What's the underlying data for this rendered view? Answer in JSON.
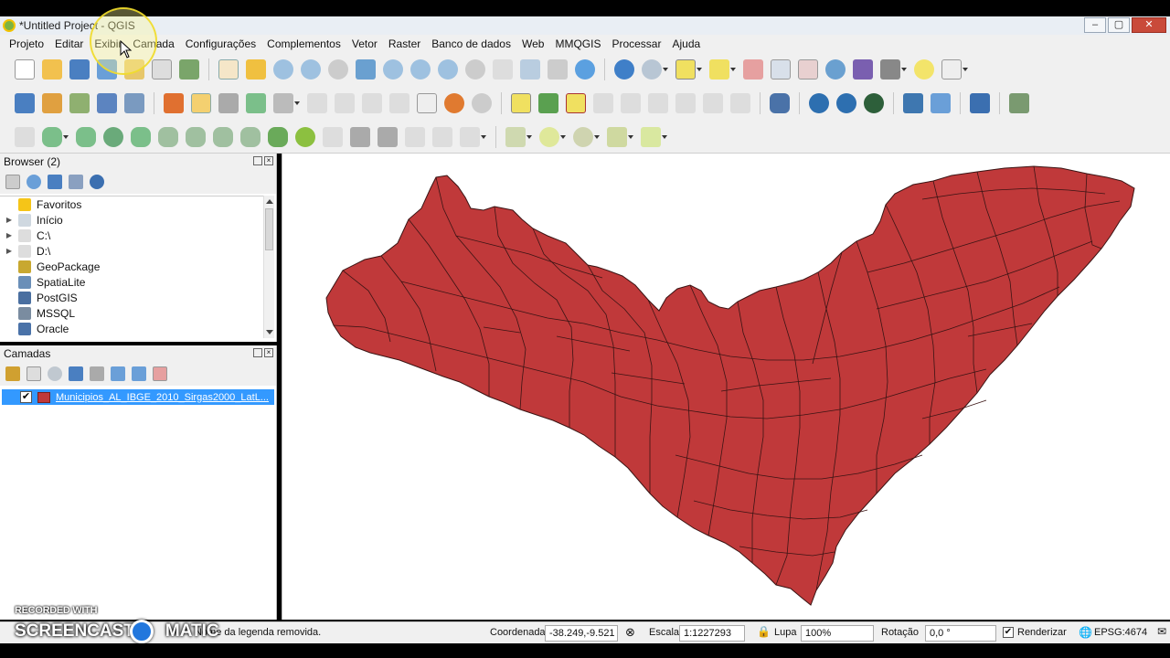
{
  "window": {
    "title": "*Untitled Project - QGIS",
    "controls": [
      "–",
      "▢",
      "✕"
    ]
  },
  "menu": [
    "Projeto",
    "Editar",
    "Exibir",
    "Camada",
    "Configurações",
    "Complementos",
    "Vetor",
    "Raster",
    "Banco de dados",
    "Web",
    "MMQGIS",
    "Processar",
    "Ajuda"
  ],
  "browser": {
    "title": "Browser (2)",
    "items": [
      {
        "label": "Favoritos",
        "icon": "star-icon",
        "expandable": false
      },
      {
        "label": "Início",
        "icon": "home-icon",
        "expandable": true
      },
      {
        "label": "C:\\",
        "icon": "drive-icon",
        "expandable": true
      },
      {
        "label": "D:\\",
        "icon": "drive-icon",
        "expandable": true
      },
      {
        "label": "GeoPackage",
        "icon": "geopackage-icon",
        "expandable": false
      },
      {
        "label": "SpatiaLite",
        "icon": "spatialite-icon",
        "expandable": false
      },
      {
        "label": "PostGIS",
        "icon": "postgis-icon",
        "expandable": false
      },
      {
        "label": "MSSQL",
        "icon": "mssql-icon",
        "expandable": false
      },
      {
        "label": "Oracle",
        "icon": "oracle-icon",
        "expandable": false
      }
    ]
  },
  "layers": {
    "title": "Camadas",
    "items": [
      {
        "name": "Municipios_AL_IBGE_2010_Sirgas2000_LatL...",
        "checked": true,
        "fill_color": "#c0393a"
      }
    ]
  },
  "map": {
    "fill_color": "#c0393a",
    "stroke_color": "#3a1414"
  },
  "statusbar": {
    "message": "Nome da legenda removida.",
    "coord_label": "Coordenada",
    "coord_value": "-38.249,-9.521",
    "scale_label": "Escala",
    "scale_value": "1:1227293",
    "magnifier_label": "Lupa",
    "magnifier_value": "100%",
    "rotation_label": "Rotação",
    "rotation_value": "0,0 °",
    "render_label": "Renderizar",
    "render_checked": true,
    "crs": "EPSG:4674"
  },
  "watermark": {
    "line1": "RECORDED WITH",
    "line2a": "SCREENCAST",
    "line2b": "MATIC"
  }
}
